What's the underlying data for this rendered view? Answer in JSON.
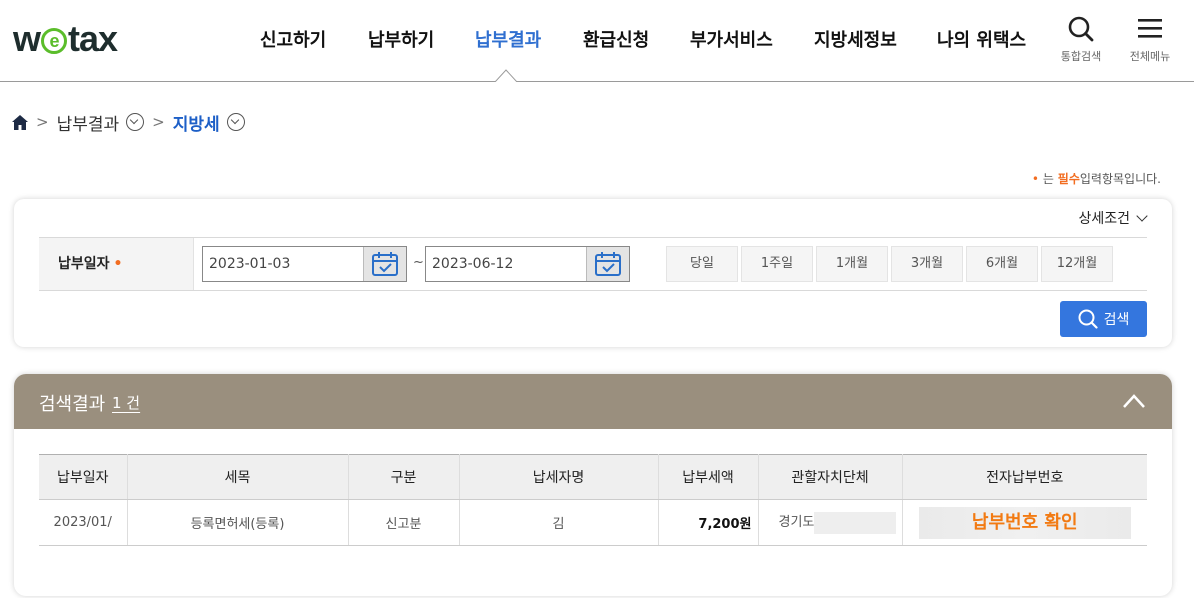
{
  "header": {
    "logo": {
      "pre": "w",
      "mid": "e",
      "post": "tax"
    },
    "nav": [
      {
        "label": "신고하기"
      },
      {
        "label": "납부하기"
      },
      {
        "label": "납부결과",
        "active": true
      },
      {
        "label": "환급신청"
      },
      {
        "label": "부가서비스"
      },
      {
        "label": "지방세정보"
      },
      {
        "label": "나의 위택스"
      }
    ],
    "search_label": "통합검색",
    "menu_label": "전체메뉴",
    "active_color": "#2f6fd0"
  },
  "breadcrumb": {
    "level1": "납부결과",
    "level2": "지방세"
  },
  "required_note": {
    "prefix": "는",
    "emphasis": "필수",
    "suffix": "입력항목입니다."
  },
  "search": {
    "advanced_label": "상세조건",
    "date_label": "납부일자",
    "date_from": "2023-01-03",
    "tilde": "~",
    "date_to": "2023-06-12",
    "period_buttons": [
      "당일",
      "1주일",
      "1개월",
      "3개월",
      "6개월",
      "12개월"
    ],
    "search_button": "검색",
    "button_color": "#3476de"
  },
  "result": {
    "title": "검색결과",
    "count": "1 건",
    "header_color": "#9a8f7e",
    "columns": [
      "납부일자",
      "세목",
      "구분",
      "납세자명",
      "납부세액",
      "관할자치단체",
      "전자납부번호"
    ],
    "rows": [
      {
        "date": "2023/01/",
        "tax_item": "등록면허세(등록)",
        "type": "신고분",
        "taxpayer": "김",
        "amount": "7,200원",
        "authority": "경기도",
        "pay_number": "납부번호 확인"
      }
    ]
  }
}
